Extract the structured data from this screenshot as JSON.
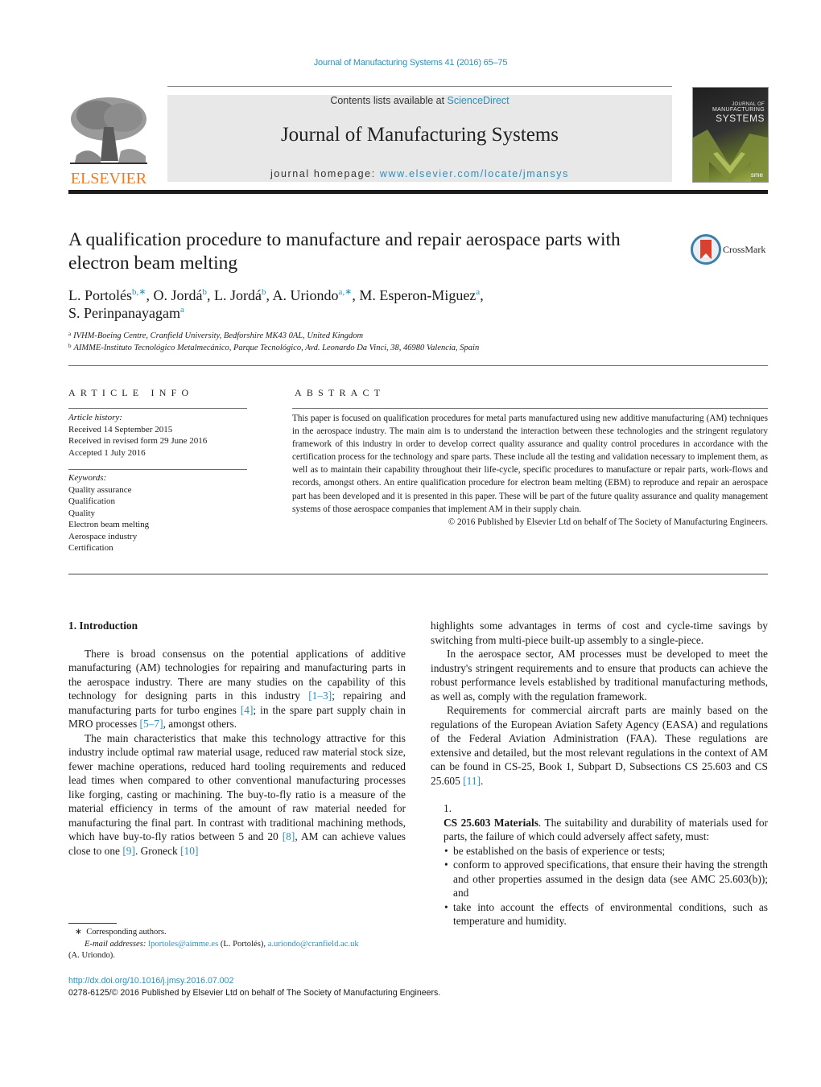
{
  "header": {
    "journal_ref": "Journal of Manufacturing Systems 41 (2016) 65–75",
    "contents_prefix": "Contents lists available at ",
    "contents_link": "ScienceDirect",
    "journal_title": "Journal of Manufacturing Systems",
    "homepage_prefix": "journal homepage: ",
    "homepage_link": "www.elsevier.com/locate/jmansys",
    "publisher_logo_text": "ELSEVIER",
    "cover_small": "JOURNAL OF",
    "cover_line1": "MANUFACTURING",
    "cover_line2": "SYSTEMS",
    "cover_badge": "sme"
  },
  "article": {
    "title": "A qualification procedure to manufacture and repair aerospace parts with electron beam melting",
    "crossmark_label": "CrossMark",
    "authors": [
      {
        "name": "L. Portolés",
        "aff": "b,∗",
        "sep": ", "
      },
      {
        "name": "O. Jordá",
        "aff": "b",
        "sep": ", "
      },
      {
        "name": "L. Jordá",
        "aff": "b",
        "sep": ", "
      },
      {
        "name": "A. Uriondo",
        "aff": "a,∗",
        "sep": ", "
      },
      {
        "name": "M. Esperon-Miguez",
        "aff": "a",
        "sep": ","
      },
      {
        "name": "S. Perinpanayagam",
        "aff": "a",
        "sep": ""
      }
    ],
    "affiliations": [
      {
        "key": "a",
        "text": "IVHM-Boeing Centre, Cranfield University, Bedforshire MK43 0AL, United Kingdom"
      },
      {
        "key": "b",
        "text": "AIMME-Instituto Tecnológico Metalmecánico, Parque Tecnológico, Avd. Leonardo Da Vinci, 38, 46980 Valencia, Spain"
      }
    ]
  },
  "article_info": {
    "heading": "ARTICLE INFO",
    "history_label": "Article history:",
    "history": [
      "Received 14 September 2015",
      "Received in revised form 29 June 2016",
      "Accepted 1 July 2016"
    ],
    "keywords_label": "Keywords:",
    "keywords": [
      "Quality assurance",
      "Qualification",
      "Quality",
      "Electron beam melting",
      "Aerospace industry",
      "Certification"
    ]
  },
  "abstract": {
    "heading": "ABSTRACT",
    "text": "This paper is focused on qualification procedures for metal parts manufactured using new additive manufacturing (AM) techniques in the aerospace industry. The main aim is to understand the interaction between these technologies and the stringent regulatory framework of this industry in order to develop correct quality assurance and quality control procedures in accordance with the certification process for the technology and spare parts. These include all the testing and validation necessary to implement them, as well as to maintain their capability throughout their life-cycle, specific procedures to manufacture or repair parts, work-flows and records, amongst others. An entire qualification procedure for electron beam melting (EBM) to reproduce and repair an aerospace part has been developed and it is presented in this paper. These will be part of the future quality assurance and quality management systems of those aerospace companies that implement AM in their supply chain.",
    "copyright": "© 2016 Published by Elsevier Ltd on behalf of The Society of Manufacturing Engineers."
  },
  "body": {
    "section1_heading": "1.  Introduction",
    "p1": {
      "a": "There is broad consensus on the potential applications of additive manufacturing (AM) technologies for repairing and manufacturing parts in the aerospace industry. There are many studies on the capability of this technology for designing parts in this industry ",
      "ref1": "[1–3]",
      "b": "; repairing and manufacturing parts for turbo engines ",
      "ref2": "[4]",
      "c": "; in the spare part supply chain in MRO processes ",
      "ref3": "[5–7]",
      "d": ", amongst others."
    },
    "p2": {
      "a": "The main characteristics that make this technology attractive for this industry include optimal raw material usage, reduced raw material stock size, fewer machine operations, reduced hard tooling requirements and reduced lead times when compared to other conventional manufacturing processes like forging, casting or machining. The buy-to-fly ratio is a measure of the material efficiency in terms of the amount of raw material needed for manufacturing the final part. In contrast with traditional machining methods, which have buy-to-fly ratios between 5 and 20 ",
      "ref1": "[8]",
      "b": ", AM can achieve values close to one ",
      "ref2": "[9]",
      "c": ". Groneck ",
      "ref3": "[10]"
    },
    "p3": "highlights some advantages in terms of cost and cycle-time savings by switching from multi-piece built-up assembly to a single-piece.",
    "p4": "In the aerospace sector, AM processes must be developed to meet the industry's stringent requirements and to ensure that products can achieve the robust performance levels established by traditional manufacturing methods, as well as, comply with the regulation framework.",
    "p5": {
      "a": "Requirements for commercial aircraft parts are mainly based on the regulations of the European Aviation Safety Agency (EASA) and regulations of the Federal Aviation Administration (FAA). These regulations are extensive and detailed, but the most relevant regulations in the context of AM can be found in CS-25, Book 1, Subpart D, Subsections CS 25.603 and CS 25.605 ",
      "ref": "[11]",
      "b": "."
    },
    "list_item1": {
      "num": "1.",
      "bold": "CS 25.603 Materials",
      "text": ". The suitability and durability of materials used for parts, the failure of which could adversely affect safety, must:",
      "bullets": [
        "be established on the basis of experience or tests;",
        "conform to approved specifications, that ensure their having the strength and other properties assumed in the design data (see AMC 25.603(b)); and",
        "take into account the effects of environmental conditions, such as temperature and humidity."
      ]
    }
  },
  "footnote": {
    "star": "∗",
    "corresponding": "Corresponding authors.",
    "email_label": "E-mail addresses:",
    "email1": "lportoles@aimme.es",
    "email1_owner": " (L. Portolés), ",
    "email2": "a.uriondo@cranfield.ac.uk",
    "email2_owner": "(A. Uriondo)."
  },
  "doi": {
    "link": "http://dx.doi.org/10.1016/j.jmsy.2016.07.002",
    "issn_line": "0278-6125/© 2016 Published by Elsevier Ltd on behalf of The Society of Manufacturing Engineers."
  },
  "colors": {
    "link": "#2e8fb8",
    "elsevier_orange": "#f07c1d",
    "banner_bg": "#e8e8e8"
  }
}
